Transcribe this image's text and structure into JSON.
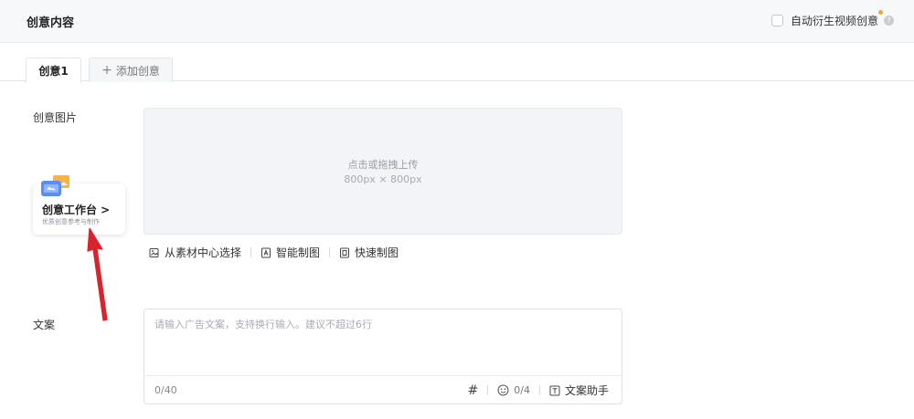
{
  "header": {
    "title": "创意内容",
    "auto_derive_label": "自动衍生视频创意",
    "help_glyph": "?"
  },
  "tabs": {
    "active_label": "创意1",
    "add_icon": "+",
    "add_label": "添加创意"
  },
  "image_section": {
    "label": "创意图片",
    "upload_hint": "点击或拖拽上传",
    "upload_size": "800px × 800px",
    "tools": [
      {
        "label": "从素材中心选择",
        "icon": "material-library-icon"
      },
      {
        "label": "智能制图",
        "icon": "ai-image-icon"
      },
      {
        "label": "快速制图",
        "icon": "quick-image-icon"
      }
    ]
  },
  "studio_card": {
    "title": "创意工作台 >",
    "subtitle": "优质创意参考与制作"
  },
  "copy_section": {
    "label": "文案",
    "placeholder": "请输入广告文案，支持换行输入。建议不超过6行",
    "char_count": "0/40",
    "hash": "#",
    "emoji_count": "0/4",
    "assistant_label": "文案助手"
  },
  "colors": {
    "annotation_arrow": "#d9232d",
    "help_dot": "#f5a623"
  }
}
